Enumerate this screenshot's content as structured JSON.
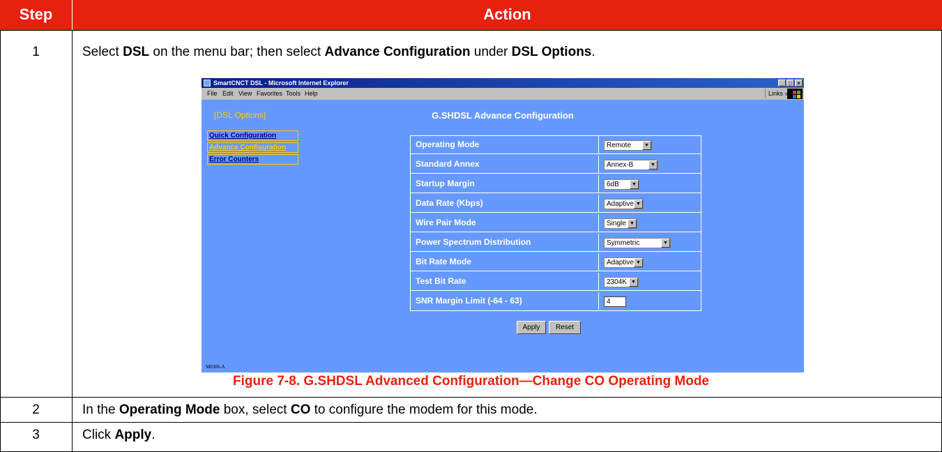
{
  "table": {
    "headers": {
      "step": "Step",
      "action": "Action"
    },
    "steps": [
      {
        "number": "1",
        "parts": [
          {
            "text": "Select ",
            "bold": false
          },
          {
            "text": "DSL",
            "bold": true
          },
          {
            "text": " on the menu bar; then select ",
            "bold": false
          },
          {
            "text": "Advance Configuration",
            "bold": true
          },
          {
            "text": " under ",
            "bold": false
          },
          {
            "text": "DSL Options",
            "bold": true
          },
          {
            "text": ".",
            "bold": false
          }
        ]
      },
      {
        "number": "2",
        "parts": [
          {
            "text": "In the ",
            "bold": false
          },
          {
            "text": "Operating Mode",
            "bold": true
          },
          {
            "text": " box, select ",
            "bold": false
          },
          {
            "text": "CO",
            "bold": true
          },
          {
            "text": " to configure the modem for this mode.",
            "bold": false
          }
        ]
      },
      {
        "number": "3",
        "parts": [
          {
            "text": "Click ",
            "bold": false
          },
          {
            "text": "Apply",
            "bold": true
          },
          {
            "text": ".",
            "bold": false
          }
        ]
      }
    ]
  },
  "screenshot": {
    "window_title": "SmartCNCT DSL - Microsoft Internet Explorer",
    "window_buttons": [
      "_",
      "□",
      "×"
    ],
    "menu": [
      "File",
      "Edit",
      "View",
      "Favorites",
      "Tools",
      "Help"
    ],
    "links_label": "Links »",
    "section_title": "[DSL Options]",
    "page_title": "G.SHDSL Advance Configuration",
    "nav": [
      {
        "label": "Quick Configuration",
        "selected": false
      },
      {
        "label": "Advance Configuration",
        "selected": true
      },
      {
        "label": "Error Counters",
        "selected": false
      }
    ],
    "fields": [
      {
        "label": "Operating Mode",
        "value": "Remote",
        "kind": "select"
      },
      {
        "label": "Standard Annex",
        "value": "Annex-B",
        "kind": "select"
      },
      {
        "label": "Startup Margin",
        "value": "6dB",
        "kind": "select"
      },
      {
        "label": "Data Rate (Kbps)",
        "value": "Adaptive",
        "kind": "select"
      },
      {
        "label": "Wire Pair Mode",
        "value": "Single",
        "kind": "select"
      },
      {
        "label": "Power Spectrum Distribution",
        "value": "Symmetric",
        "kind": "select"
      },
      {
        "label": "Bit Rate Mode",
        "value": "Adaptive",
        "kind": "select"
      },
      {
        "label": "Test Bit Rate",
        "value": "2304K",
        "kind": "select"
      },
      {
        "label": "SNR Margin Limit (-64 - 63)",
        "value": "4",
        "kind": "text"
      }
    ],
    "apply_label": "Apply",
    "reset_label": "Reset",
    "stamp": "M0306-A"
  },
  "caption": "Figure 7-8. G.SHDSL Advanced Configuration—Change CO Operating Mode",
  "colors": {
    "header_bg": "#e8200e",
    "caption": "#e8200e",
    "screenshot_bg": "#6699ff",
    "nav_selected": "#ffcc00",
    "nav_link": "#000080"
  }
}
